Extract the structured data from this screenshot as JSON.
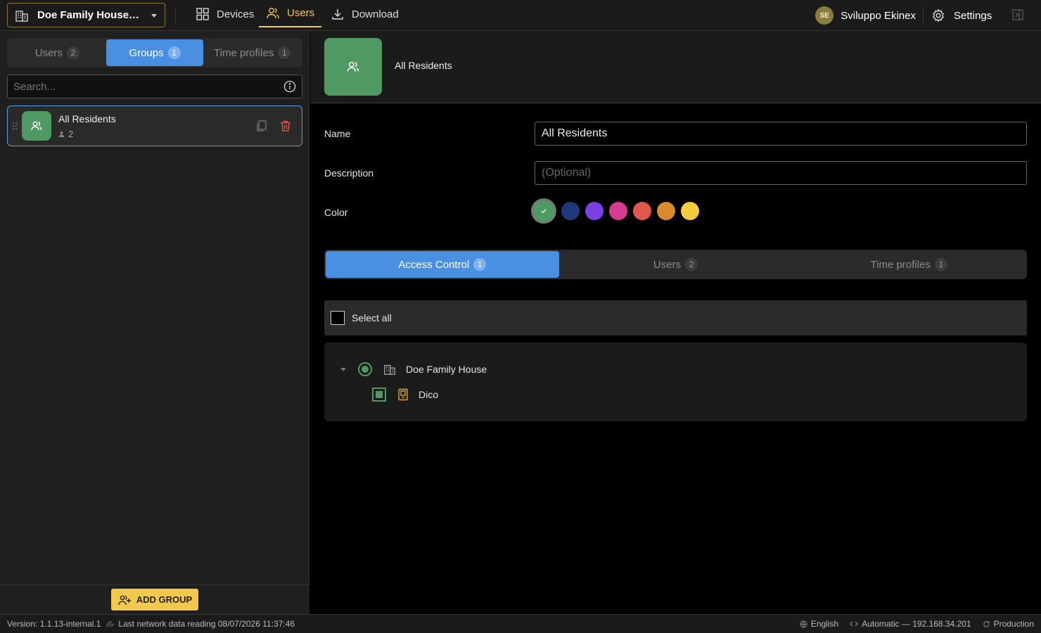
{
  "topbar": {
    "project": "Doe Family House Pro...",
    "nav": [
      {
        "label": "Devices",
        "icon": "grid-icon"
      },
      {
        "label": "Users",
        "icon": "users-icon",
        "active": true
      },
      {
        "label": "Download",
        "icon": "download-icon"
      }
    ],
    "user_initials": "SE",
    "user_name": "Sviluppo Ekinex",
    "settings_label": "Settings"
  },
  "left": {
    "tabs": [
      {
        "label": "Users",
        "count": "2"
      },
      {
        "label": "Groups",
        "count": "1",
        "active": true
      },
      {
        "label": "Time profiles",
        "count": "1"
      }
    ],
    "search_placeholder": "Search...",
    "groups": [
      {
        "name": "All Residents",
        "members": "2",
        "color": "#4f9a63"
      }
    ],
    "add_label": "ADD GROUP"
  },
  "detail": {
    "title": "All Residents",
    "name_label": "Name",
    "name_value": "All Residents",
    "description_label": "Description",
    "description_placeholder": "(Optional)",
    "color_label": "Color",
    "colors": [
      "#4f9a63",
      "#1f3a7a",
      "#7b3fe4",
      "#d63d92",
      "#e0584b",
      "#d98b2b",
      "#f5cc3d"
    ],
    "selected_color": "#4f9a63",
    "tabs": [
      {
        "label": "Access Control",
        "count": "1",
        "active": true
      },
      {
        "label": "Users",
        "count": "2"
      },
      {
        "label": "Time profiles",
        "count": "1"
      }
    ],
    "select_all_label": "Select all",
    "tree": {
      "root": "Doe Family House",
      "children": [
        "Dico"
      ]
    }
  },
  "status": {
    "version": "Version: 1.1.13-internal.1",
    "last_reading": "Last network data reading 08/07/2026 11:37:46",
    "language": "English",
    "connection": "Automatic — 192.168.34.201",
    "environment": "Production"
  },
  "colors": {
    "accent": "#f2c94c",
    "primary": "#4a90e2",
    "group_green": "#4f9a63",
    "danger": "#e0584b"
  }
}
